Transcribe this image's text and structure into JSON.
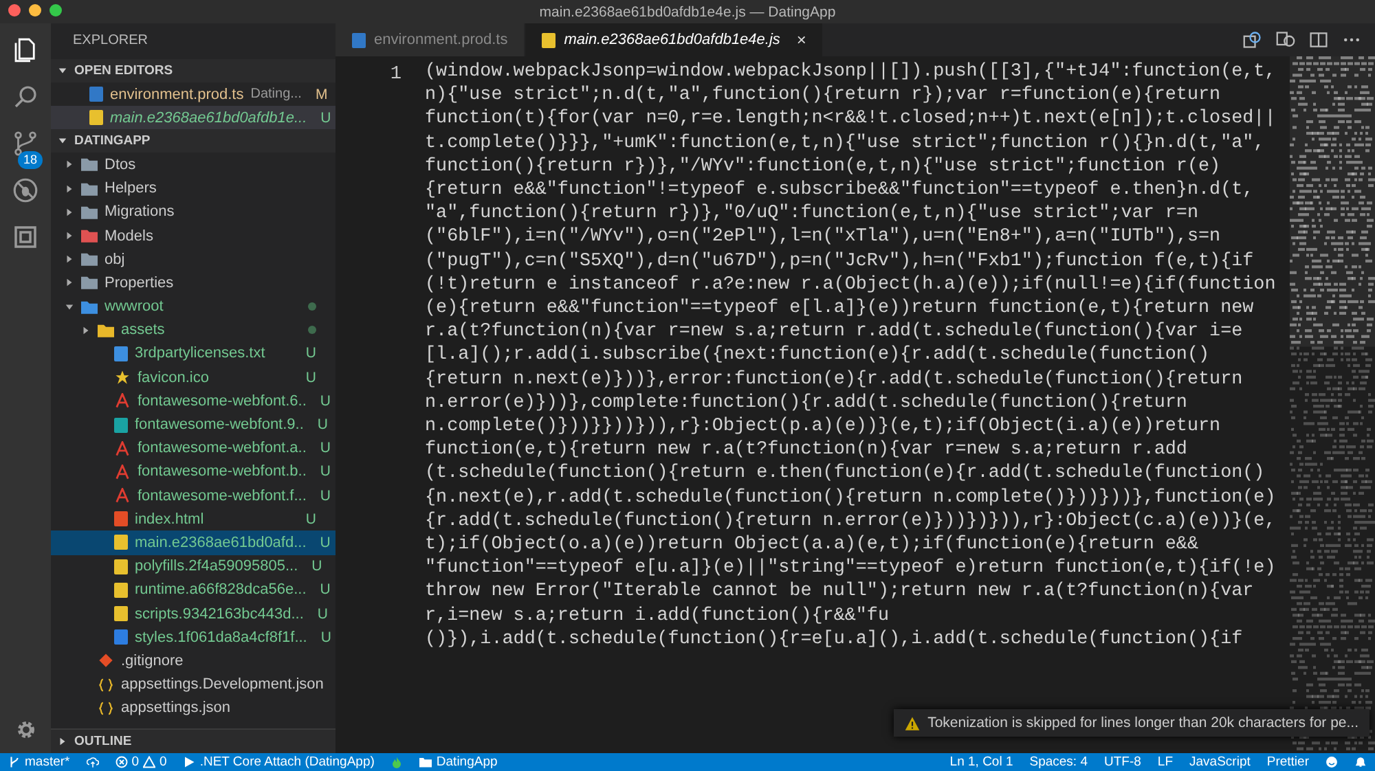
{
  "window": {
    "title": "main.e2368ae61bd0afdb1e4e.js — DatingApp"
  },
  "activity_bar": {
    "source_control_badge": "18"
  },
  "sidebar": {
    "title": "EXPLORER",
    "open_editors": {
      "title": "OPEN EDITORS",
      "expanded": true,
      "items": [
        {
          "name": "environment.prod.ts",
          "description": "Dating...",
          "status": "M",
          "color": "#e2c08d",
          "kind": "ts",
          "selected": false
        },
        {
          "name": "main.e2368ae61bd0afdb1e...",
          "status": "U",
          "color": "#73c991",
          "kind": "js",
          "selected": true
        }
      ]
    },
    "project": {
      "title": "DATINGAPP",
      "expanded": true,
      "tree": [
        {
          "name": "Dtos",
          "kind": "folder",
          "expanded": false,
          "selected": false
        },
        {
          "name": "Helpers",
          "kind": "folder",
          "expanded": false,
          "selected": false
        },
        {
          "name": "Migrations",
          "kind": "folder",
          "expanded": false,
          "selected": false
        },
        {
          "name": "Models",
          "kind": "models-folder",
          "expanded": false,
          "selected": false
        },
        {
          "name": "obj",
          "kind": "folder",
          "expanded": false,
          "selected": false
        },
        {
          "name": "Properties",
          "kind": "folder",
          "expanded": false,
          "selected": false
        },
        {
          "name": "wwwroot",
          "kind": "web-folder",
          "expanded": true,
          "selected": false,
          "color": "#73c991",
          "dot": true,
          "children": [
            {
              "name": "assets",
              "kind": "assets-folder",
              "expanded": false,
              "selected": false,
              "color": "#73c991",
              "dot": true
            },
            {
              "name": "3rdpartylicenses.txt",
              "kind": "txt",
              "status": "U",
              "color": "#73c991",
              "selected": false
            },
            {
              "name": "favicon.ico",
              "kind": "star",
              "status": "U",
              "color": "#73c991",
              "selected": false
            },
            {
              "name": "fontawesome-webfont.6..",
              "kind": "font",
              "status": "U",
              "color": "#73c991",
              "selected": false
            },
            {
              "name": "fontawesome-webfont.9..",
              "kind": "svg",
              "status": "U",
              "color": "#73c991",
              "selected": false
            },
            {
              "name": "fontawesome-webfont.a..",
              "kind": "font",
              "status": "U",
              "color": "#73c991",
              "selected": false
            },
            {
              "name": "fontawesome-webfont.b..",
              "kind": "font",
              "status": "U",
              "color": "#73c991",
              "selected": false
            },
            {
              "name": "fontawesome-webfont.f...",
              "kind": "font",
              "status": "U",
              "color": "#73c991",
              "selected": false
            },
            {
              "name": "index.html",
              "kind": "html",
              "status": "U",
              "color": "#73c991",
              "selected": false
            },
            {
              "name": "main.e2368ae61bd0afd...",
              "kind": "js",
              "status": "U",
              "color": "#73c991",
              "selected": true
            },
            {
              "name": "polyfills.2f4a59095805...",
              "kind": "js",
              "status": "U",
              "color": "#73c991",
              "selected": false
            },
            {
              "name": "runtime.a66f828dca56e...",
              "kind": "js",
              "status": "U",
              "color": "#73c991",
              "selected": false
            },
            {
              "name": "scripts.9342163bc443d...",
              "kind": "js",
              "status": "U",
              "color": "#73c991",
              "selected": false
            },
            {
              "name": "styles.1f061da8a4cf8f1f...",
              "kind": "css",
              "status": "U",
              "color": "#73c991",
              "selected": false
            }
          ]
        },
        {
          "name": ".gitignore",
          "kind": "git",
          "selected": false
        },
        {
          "name": "appsettings.Development.json",
          "kind": "json",
          "selected": false
        },
        {
          "name": "appsettings.json",
          "kind": "json",
          "selected": false
        }
      ]
    },
    "outline": {
      "title": "OUTLINE",
      "expanded": false
    }
  },
  "tabs": [
    {
      "name": "environment.prod.ts",
      "kind": "ts",
      "selected": false
    },
    {
      "name": "main.e2368ae61bd0afdb1e4e.js",
      "kind": "js",
      "selected": true,
      "close": "×"
    }
  ],
  "editor": {
    "line_number": "1",
    "lines": [
      "(window.webpackJsonp=window.webpackJsonp||[]).push([[3],{\"+tJ4\":function(e,t,",
      "n){\"use strict\";n.d(t,\"a\",function(){return r});var r=function(e){return",
      "function(t){for(var n=0,r=e.length;n<r&&!t.closed;n++)t.next(e[n]);t.closed||",
      "t.complete()}}},\"+umK\":function(e,t,n){\"use strict\";function r(){}n.d(t,\"a\",",
      "function(){return r})},\"/WYv\":function(e,t,n){\"use strict\";function r(e)",
      "{return e&&\"function\"!=typeof e.subscribe&&\"function\"==typeof e.then}n.d(t,",
      "\"a\",function(){return r})},\"0/uQ\":function(e,t,n){\"use strict\";var r=n",
      "(\"6blF\"),i=n(\"/WYv\"),o=n(\"2ePl\"),l=n(\"xTla\"),u=n(\"En8+\"),a=n(\"IUTb\"),s=n",
      "(\"pugT\"),c=n(\"S5XQ\"),d=n(\"u67D\"),p=n(\"JcRv\"),h=n(\"Fxb1\");function f(e,t){if",
      "(!t)return e instanceof r.a?e:new r.a(Object(h.a)(e));if(null!=e){if(function",
      "(e){return e&&\"function\"==typeof e[l.a]}(e))return function(e,t){return new",
      "r.a(t?function(n){var r=new s.a;return r.add(t.schedule(function(){var i=e",
      "[l.a]();r.add(i.subscribe({next:function(e){r.add(t.schedule(function()",
      "{return n.next(e)}))},error:function(e){r.add(t.schedule(function(){return",
      "n.error(e)}))},complete:function(){r.add(t.schedule(function(){return",
      "n.complete()}))}}))})),r}:Object(p.a)(e))}(e,t);if(Object(i.a)(e))return",
      "function(e,t){return new r.a(t?function(n){var r=new s.a;return r.add",
      "(t.schedule(function(){return e.then(function(e){r.add(t.schedule(function()",
      "{n.next(e),r.add(t.schedule(function(){return n.complete()}))}))},function(e)",
      "{r.add(t.schedule(function(){return n.error(e)}))})})),r}:Object(c.a)(e))}(e,",
      "t);if(Object(o.a)(e))return Object(a.a)(e,t);if(function(e){return e&&",
      "\"function\"==typeof e[u.a]}(e)||\"string\"==typeof e)return function(e,t){if(!e)",
      "throw new Error(\"Iterable cannot be null\");return new r.a(t?function(n){var",
      "r,i=new s.a;return i.add(function(){r&&\"fu",
      "()}),i.add(t.schedule(function(){r=e[u.a](),i.add(t.schedule(function(){if"
    ]
  },
  "notification": {
    "message": "Tokenization is skipped for lines longer than 20k characters for pe..."
  },
  "status_bar": {
    "branch": "master*",
    "errors": "0",
    "warnings": "0",
    "debug": ".NET Core Attach (DatingApp)",
    "folder": "DatingApp",
    "right": [
      "Ln 1, Col 1",
      "Spaces: 4",
      "UTF-8",
      "LF",
      "JavaScript",
      "Prettier"
    ]
  }
}
